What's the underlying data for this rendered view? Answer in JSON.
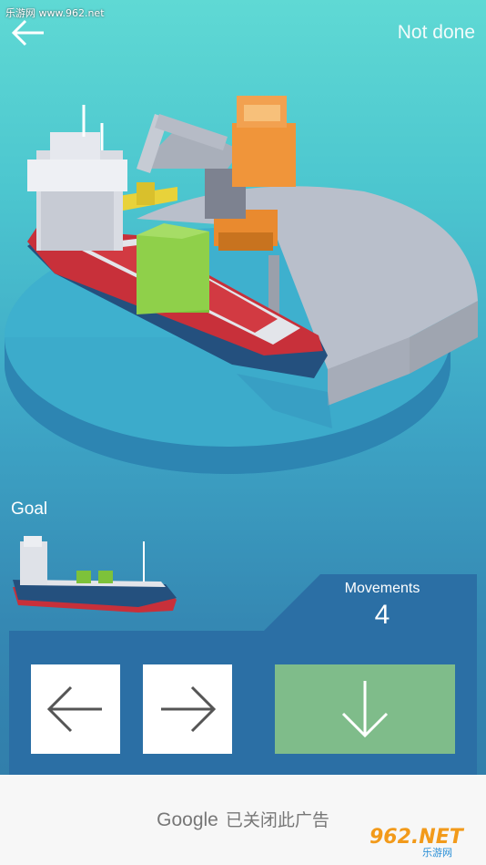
{
  "watermark": "乐游网 www.962.net",
  "header": {
    "status": "Not done"
  },
  "goal": {
    "label": "Goal"
  },
  "movements": {
    "label": "Movements",
    "count": "4"
  },
  "controls": {
    "left_icon": "arrow-left-icon",
    "right_icon": "arrow-right-icon",
    "drop_icon": "arrow-down-icon"
  },
  "ad": {
    "brand": "Google",
    "text": "已关闭此广告"
  },
  "site_logo": {
    "text": "962.NET",
    "subtext": "乐游网"
  },
  "colors": {
    "drop_button": "#7fbc8a",
    "panel": "#2b6fa5",
    "hull_red": "#c8303a",
    "hull_blue": "#24507e",
    "container_green": "#7dc23a",
    "crane_orange": "#f0953a",
    "dock_gray": "#b8bdc8"
  }
}
